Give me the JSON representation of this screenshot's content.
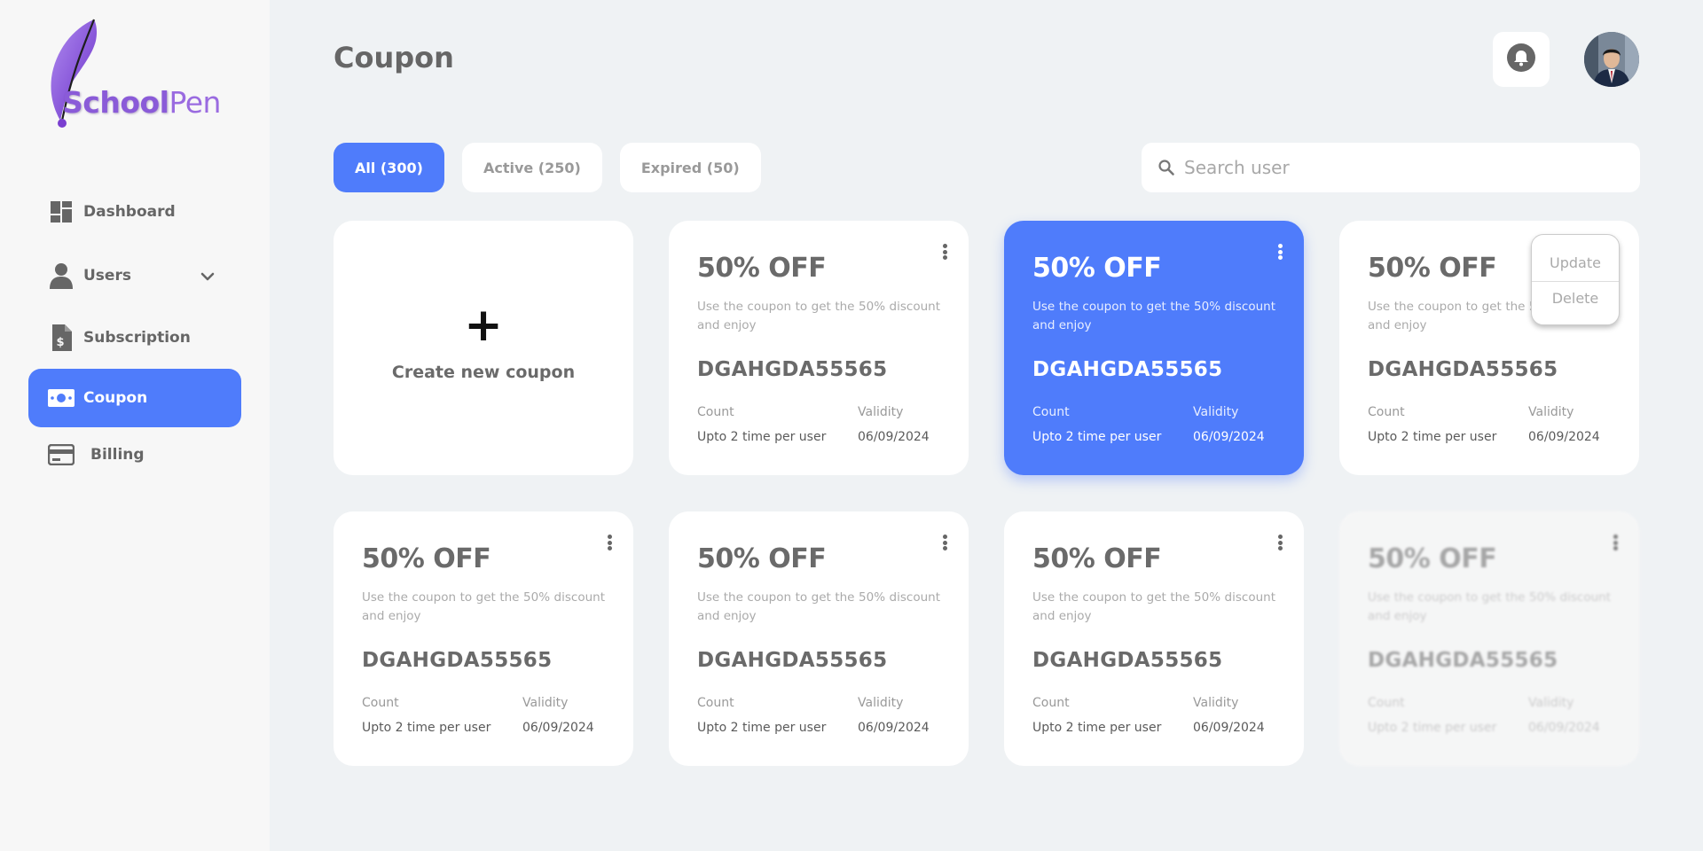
{
  "brand": {
    "part1": "School",
    "part2": "Pen"
  },
  "sidebar": {
    "items": [
      {
        "label": "Dashboard",
        "icon": "dashboard-icon"
      },
      {
        "label": "Users",
        "icon": "user-icon",
        "expandable": true
      },
      {
        "label": "Subscription",
        "icon": "invoice-dollar-icon"
      },
      {
        "label": "Coupon",
        "icon": "money-bill-icon",
        "active": true
      },
      {
        "label": "Billing",
        "icon": "credit-card-icon"
      }
    ]
  },
  "header": {
    "title": "Coupon",
    "bell_icon": "bell-icon",
    "avatar": "user-avatar"
  },
  "filters": [
    {
      "label": "All (300)",
      "active": true
    },
    {
      "label": "Active  (250)",
      "active": false
    },
    {
      "label": "Expired (50)",
      "active": false
    }
  ],
  "search": {
    "placeholder": "Search user",
    "value": ""
  },
  "create_card": {
    "label": "Create new coupon",
    "plus": "+"
  },
  "coupons": [
    {
      "off": "50% OFF",
      "desc": "Use the coupon to get the 50% discount and enjoy",
      "code": "DGAHGDA55565",
      "count_label": "Count",
      "validity_label": "Validity",
      "count": "Upto 2 time per user",
      "validity": "06/09/2024",
      "state": "normal"
    },
    {
      "off": "50% OFF",
      "desc": "Use the coupon to get the 50% discount and enjoy",
      "code": "DGAHGDA55565",
      "count_label": "Count",
      "validity_label": "Validity",
      "count": "Upto 2 time per user",
      "validity": "06/09/2024",
      "state": "highlighted"
    },
    {
      "off": "50% OFF",
      "desc": "Use the coupon to get the 50% discount and enjoy",
      "code": "DGAHGDA55565",
      "count_label": "Count",
      "validity_label": "Validity",
      "count": "Upto 2 time per user",
      "validity": "06/09/2024",
      "state": "menu-open"
    },
    {
      "off": "50% OFF",
      "desc": "Use the coupon to get the 50% discount and enjoy",
      "code": "DGAHGDA55565",
      "count_label": "Count",
      "validity_label": "Validity",
      "count": "Upto 2 time per user",
      "validity": "06/09/2024",
      "state": "normal"
    },
    {
      "off": "50% OFF",
      "desc": "Use the coupon to get the 50% discount and enjoy",
      "code": "DGAHGDA55565",
      "count_label": "Count",
      "validity_label": "Validity",
      "count": "Upto 2 time per user",
      "validity": "06/09/2024",
      "state": "normal"
    },
    {
      "off": "50% OFF",
      "desc": "Use the coupon to get the 50% discount and enjoy",
      "code": "DGAHGDA55565",
      "count_label": "Count",
      "validity_label": "Validity",
      "count": "Upto 2 time per user",
      "validity": "06/09/2024",
      "state": "normal"
    },
    {
      "off": "50% OFF",
      "desc": "Use the coupon to get the 50% discount and enjoy",
      "code": "DGAHGDA55565",
      "count_label": "Count",
      "validity_label": "Validity",
      "count": "Upto 2 time per user",
      "validity": "06/09/2024",
      "state": "faded"
    }
  ],
  "context_menu": {
    "update": "Update",
    "delete": "Delete"
  },
  "colors": {
    "accent": "#4f7cfb",
    "brand_purple": "#8a5bd8",
    "background": "#eff2f4",
    "sidebar": "#f7f7f7"
  }
}
